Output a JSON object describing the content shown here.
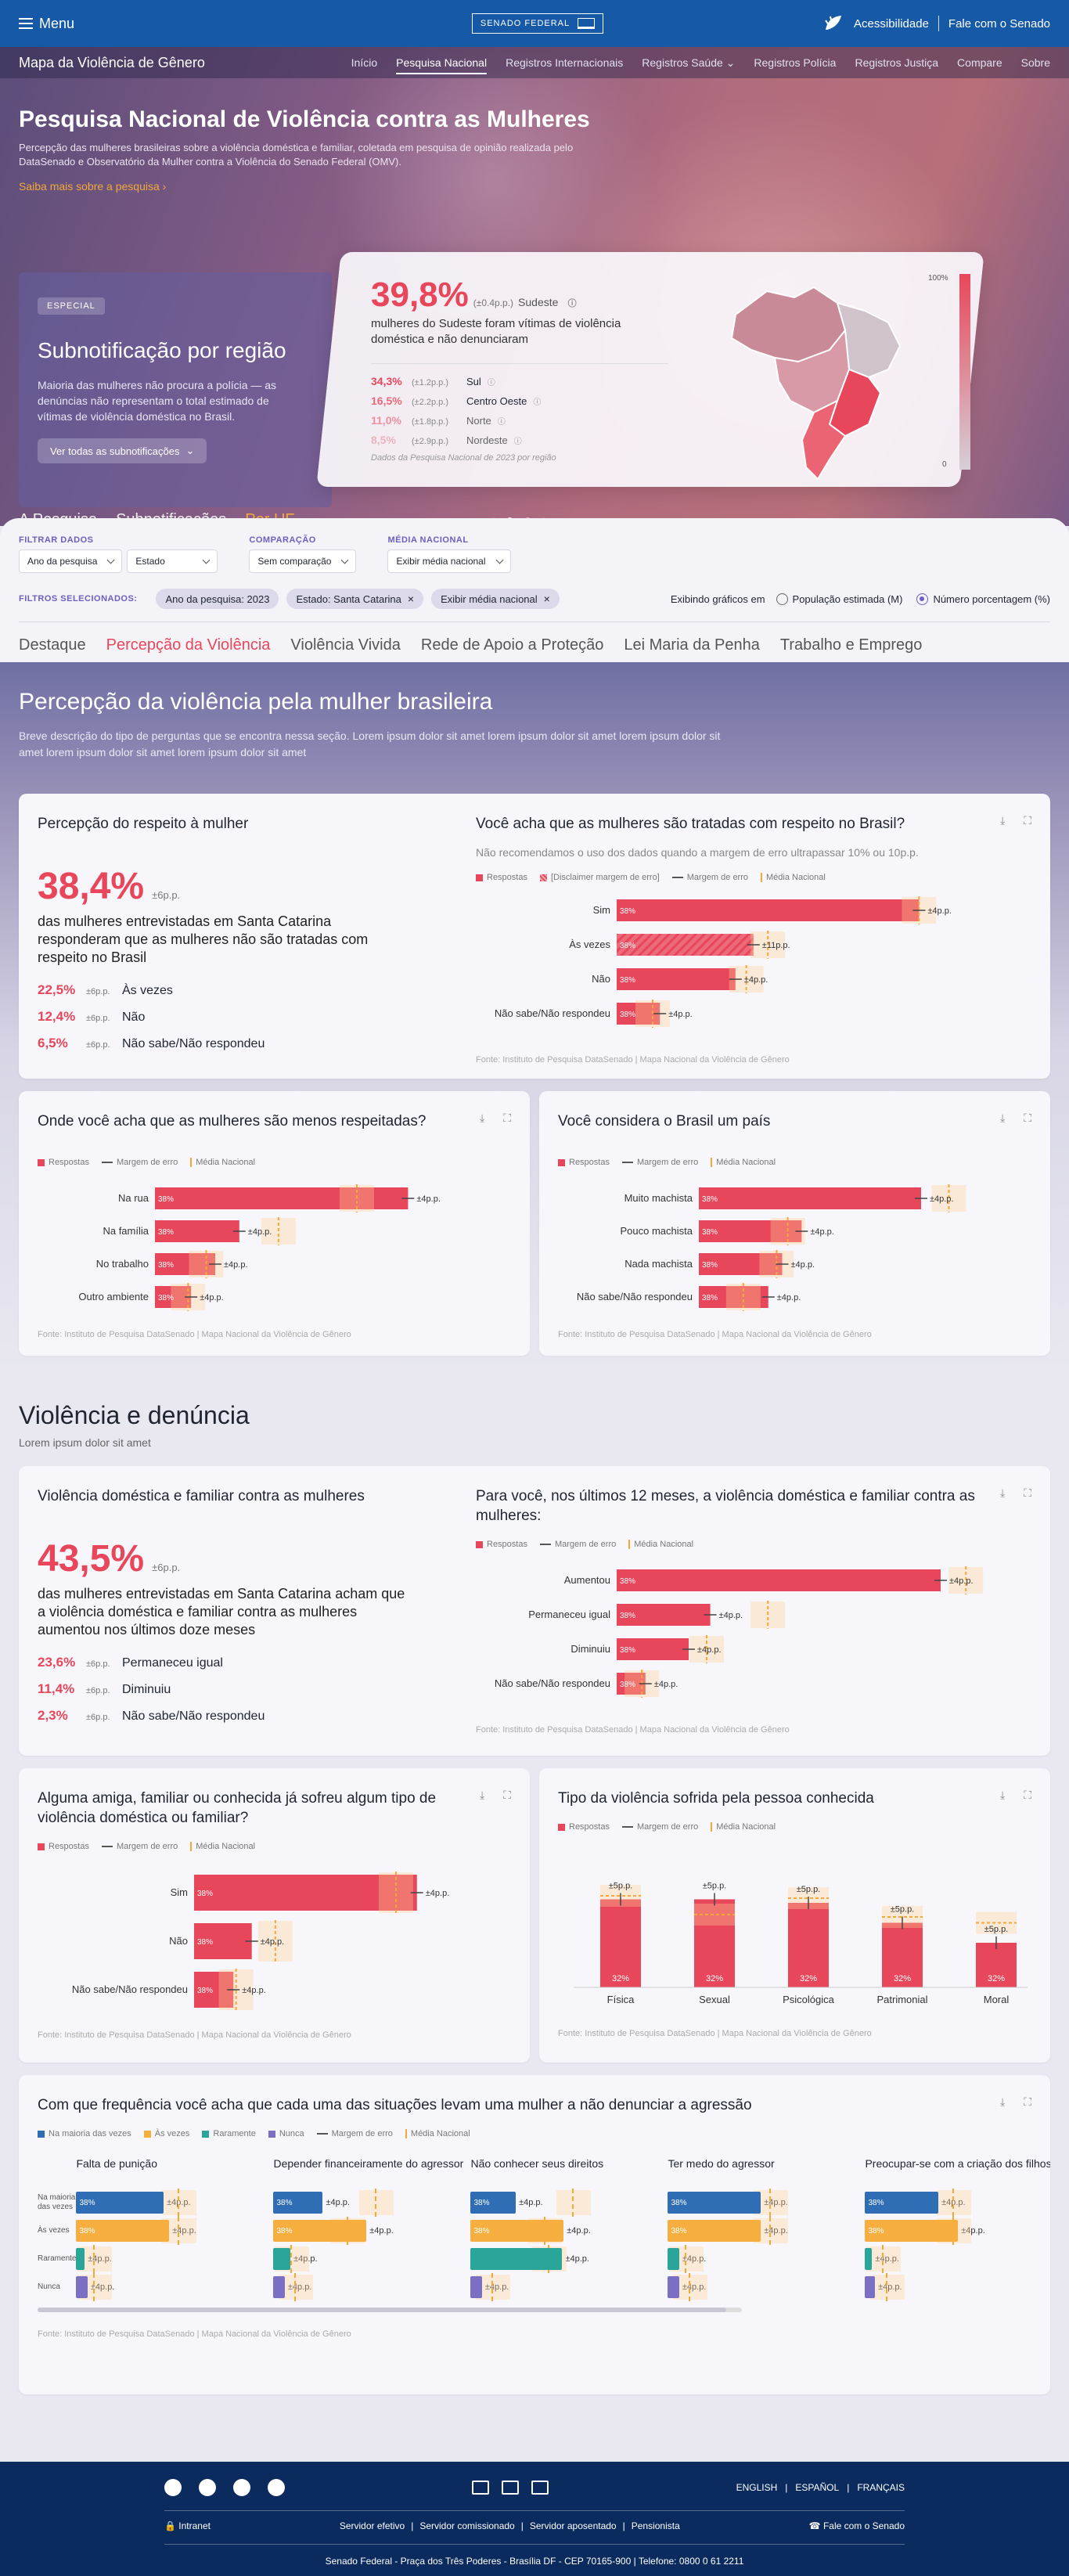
{
  "topbar": {
    "menu": "Menu",
    "logo": "SENADO FEDERAL",
    "accessibility": "Acessibilidade",
    "contact": "Fale com o Senado"
  },
  "subnav": {
    "brand": "Mapa da Violência de Gênero",
    "items": [
      "Início",
      "Pesquisa Nacional",
      "Registros Internacionais",
      "Registros Saúde",
      "Registros Polícia",
      "Registros Justiça",
      "Compare",
      "Sobre"
    ],
    "active": 1
  },
  "hero": {
    "title": "Pesquisa Nacional de Violência contra as Mulheres",
    "description": "Percepção das mulheres brasileiras sobre a violência doméstica e familiar, coletada em pesquisa de opinião realizada pelo DataSenado e Observatório da Mulher contra a Violência do Senado Federal (OMV).",
    "more": "Saiba mais sobre a pesquisa",
    "card": {
      "tag": "ESPECIAL",
      "title": "Subnotificação por região",
      "text": "Maioria das mulheres não procura a polícia — as denúncias não representam o total estimado de vítimas de violência doméstica no Brasil.",
      "button": "Ver todas as subnotificações"
    },
    "stat": {
      "value": "39,8%",
      "margin": "(±0.4p.p.)",
      "region": "Sudeste",
      "desc": "mulheres do Sudeste foram vítimas de violência doméstica e não denunciaram",
      "others": [
        {
          "value": "34,3%",
          "margin": "(±1.2p.p.)",
          "region": "Sul"
        },
        {
          "value": "16,5%",
          "margin": "(±2.2p.p.)",
          "region": "Centro Oeste"
        },
        {
          "value": "11,0%",
          "margin": "(±1.8p.p.)",
          "region": "Norte"
        },
        {
          "value": "8,5%",
          "margin": "(±2.9p.p.)",
          "region": "Nordeste"
        }
      ],
      "source": "Dados da Pesquisa Nacional de 2023 por região",
      "scale_max": "100%",
      "scale_min": "0"
    },
    "tabs": [
      "A Pesquisa",
      "Subnotificações",
      "Por UF"
    ],
    "active_tab": 2
  },
  "filters": {
    "groups": [
      {
        "label": "FILTRAR DADOS",
        "selects": [
          "Ano da pesquisa",
          "Estado"
        ]
      },
      {
        "label": "COMPARAÇÃO",
        "selects": [
          "Sem comparação"
        ]
      },
      {
        "label": "MÉDIA NACIONAL",
        "selects": [
          "Exibir média nacional"
        ]
      }
    ],
    "selected_label": "FILTROS SELECIONADOS:",
    "chips": [
      "Ano da pesquisa: 2023",
      "Estado: Santa Catarina",
      "Exibir média nacional"
    ],
    "showing_label": "Exibindo gráficos em",
    "options": [
      "População estimada (M)",
      "Número porcentagem (%)"
    ],
    "option_selected": 1,
    "section_tabs": [
      "Destaque",
      "Percepção da Violência",
      "Violência Vivida",
      "Rede de Apoio a Proteção",
      "Lei Maria da Penha",
      "Trabalho e Emprego"
    ],
    "section_active": 1
  },
  "section1": {
    "title": "Percepção da violência pela mulher brasileira",
    "desc": "Breve descrição do tipo de perguntas que se encontra nessa seção. Lorem ipsum dolor sit amet lorem ipsum dolor sit amet lorem ipsum dolor sit amet lorem ipsum dolor sit amet lorem ipsum dolor sit amet",
    "respect": {
      "title": "Percepção do respeito à mulher",
      "value": "38,4%",
      "margin": "±6p.p.",
      "text": "das mulheres entrevistadas em Santa Catarina responderam que as mulheres não são tratadas com respeito no Brasil",
      "items": [
        {
          "value": "22,5%",
          "margin": "±6p.p.",
          "label": "Às vezes"
        },
        {
          "value": "12,4%",
          "margin": "±6p.p.",
          "label": "Não"
        },
        {
          "value": "6,5%",
          "margin": "±6p.p.",
          "label": "Não sabe/Não respondeu"
        }
      ]
    },
    "q1": {
      "title": "Você acha que as mulheres são tratadas com respeito no Brasil?",
      "subtitle": "Não recomendamos o uso dos dados quando a margem de erro ultrapassar 10% ou 10p.p.",
      "legend": [
        "Respostas",
        "[Disclaimer margem de erro]",
        "Margem de erro",
        "Média Nacional"
      ],
      "source": "Fonte: Instituto de Pesquisa DataSenado | Mapa Nacional da Violência de Gênero"
    },
    "q2": {
      "title": "Onde você acha que as mulheres são menos respeitadas?",
      "legend": [
        "Respostas",
        "Margem de erro",
        "Média Nacional"
      ],
      "source": "Fonte: Instituto de Pesquisa DataSenado | Mapa Nacional da Violência de Gênero"
    },
    "q3": {
      "title": "Você considera o Brasil um país",
      "legend": [
        "Respostas",
        "Margem de erro",
        "Média Nacional"
      ],
      "source": "Fonte: Instituto de Pesquisa DataSenado | Mapa Nacional da Violência de Gênero"
    }
  },
  "section2": {
    "title": "Violência e denúncia",
    "desc": "Lorem ipsum dolor sit amet",
    "dom": {
      "title": "Violência doméstica e familiar contra as mulheres",
      "value": "43,5%",
      "margin": "±6p.p.",
      "text": "das mulheres entrevistadas em Santa Catarina acham que a violência doméstica e familiar contra as mulheres aumentou nos últimos doze meses",
      "items": [
        {
          "value": "23,6%",
          "margin": "±6p.p.",
          "label": "Permaneceu igual"
        },
        {
          "value": "11,4%",
          "margin": "±6p.p.",
          "label": "Diminuiu"
        },
        {
          "value": "2,3%",
          "margin": "±6p.p.",
          "label": "Não sabe/Não respondeu"
        }
      ]
    },
    "q4": {
      "title": "Para você, nos últimos 12 meses, a violência doméstica e familiar contra as mulheres:",
      "legend": [
        "Respostas",
        "Margem de erro",
        "Média Nacional"
      ],
      "source": "Fonte: Instituto de Pesquisa DataSenado | Mapa Nacional da Violência de Gênero"
    },
    "q5": {
      "title": "Alguma amiga, familiar ou conhecida já sofreu algum tipo de violência doméstica ou familiar?",
      "legend": [
        "Respostas",
        "Margem de erro",
        "Média Nacional"
      ],
      "source": "Fonte: Instituto de Pesquisa DataSenado | Mapa Nacional da Violência de Gênero"
    },
    "q6": {
      "title": "Tipo da violência sofrida pela pessoa conhecida",
      "legend": [
        "Respostas",
        "Margem de erro",
        "Média Nacional"
      ],
      "source": "Fonte: Instituto de Pesquisa DataSenado | Mapa Nacional da Violência de Gênero"
    },
    "q7": {
      "title": "Com que frequência você acha que cada uma das situações levam uma mulher a não denunciar a agressão",
      "legend": [
        "Na maioria das vezes",
        "Às vezes",
        "Raramente",
        "Nunca",
        "Margem de erro",
        "Média Nacional"
      ],
      "rows": [
        "Na maioria das vezes",
        "Às vezes",
        "Raramente",
        "Nunca"
      ],
      "columns": [
        "Falta de punição",
        "Depender financeiramente do agressor",
        "Não conhecer seus direitos",
        "Ter medo do agressor",
        "Preocupar-se com a criação dos filhos"
      ],
      "source": "Fonte: Instituto de Pesquisa DataSenado | Mapa Nacional da Violência de Gênero"
    }
  },
  "colors": {
    "accent": "#e8465a",
    "primary": "#1559a7",
    "purple": "#6b5fc1",
    "orange": "#f3a83a",
    "footer": "#0b2a5e",
    "q7": [
      "#2f6db5",
      "#f6ae3f",
      "#2aa59a",
      "#7a6fc2"
    ]
  },
  "chart_data": [
    {
      "type": "bar",
      "title": "Você acha que as mulheres são tratadas com respeito no Brasil?",
      "categories": [
        "Sim",
        "Às vezes",
        "Não",
        "Não sabe/Não respondeu"
      ],
      "values": [
        38,
        38,
        38,
        38
      ],
      "bar_label": "38%",
      "margins": [
        "±4p.p.",
        "±11p.p.",
        "±4p.p.",
        "±4p.p."
      ],
      "widths": [
        0.84,
        0.38,
        0.33,
        0.12
      ],
      "nat": [
        0.84,
        0.42,
        0.36,
        0.1
      ],
      "warn": [
        false,
        true,
        false,
        false
      ]
    },
    {
      "type": "bar",
      "title": "Onde você acha que as mulheres são menos respeitadas?",
      "categories": [
        "Na rua",
        "Na família",
        "No trabalho",
        "Outro ambiente"
      ],
      "values": [
        38,
        38,
        38,
        38
      ],
      "bar_label": "38%",
      "margins": [
        "±4p.p.",
        "±4p.p.",
        "±4p.p.",
        "±4p.p."
      ],
      "widths": [
        0.84,
        0.28,
        0.2,
        0.12
      ],
      "nat": [
        0.67,
        0.41,
        0.17,
        0.11
      ]
    },
    {
      "type": "bar",
      "title": "Você considera o Brasil um país",
      "categories": [
        "Muito machista",
        "Pouco machista",
        "Nada machista",
        "Não sabe/Não respondeu"
      ],
      "values": [
        38,
        38,
        38,
        38
      ],
      "bar_label": "38%",
      "margins": [
        "±4p.p.",
        "±4p.p.",
        "±4p.p.",
        "±4p.p."
      ],
      "widths": [
        0.8,
        0.37,
        0.3,
        0.25
      ],
      "nat": [
        0.9,
        0.32,
        0.28,
        0.16
      ]
    },
    {
      "type": "bar",
      "title": "Para você, nos últimos 12 meses, a violência doméstica e familiar contra as mulheres:",
      "categories": [
        "Aumentou",
        "Permaneceu igual",
        "Diminuiu",
        "Não sabe/Não respondeu"
      ],
      "values": [
        38,
        38,
        38,
        38
      ],
      "bar_label": "38%",
      "margins": [
        "±4p.p.",
        "±4p.p.",
        "±4p.p.",
        "±4p.p."
      ],
      "widths": [
        0.9,
        0.26,
        0.2,
        0.08
      ],
      "nat": [
        0.97,
        0.42,
        0.25,
        0.07
      ]
    },
    {
      "type": "bar",
      "title": "Alguma amiga, familiar ou conhecida já sofreu algum tipo de violência doméstica ou familiar?",
      "categories": [
        "Sim",
        "Não",
        "Não sabe/Não respondeu"
      ],
      "values": [
        38,
        38,
        38
      ],
      "bar_label": "38%",
      "margins": [
        "±4p.p.",
        "±4p.p.",
        "±4p.p."
      ],
      "widths": [
        0.85,
        0.22,
        0.15
      ],
      "nat": [
        0.77,
        0.31,
        0.16
      ]
    },
    {
      "type": "bar",
      "title": "Tipo da violência sofrida pela pessoa conhecida",
      "categories": [
        "Física",
        "Sexual",
        "Psicológica",
        "Patrimonial",
        "Moral"
      ],
      "values": [
        32,
        32,
        32,
        32,
        32
      ],
      "bar_label": "32%",
      "margins": [
        "±5p.p.",
        "±5p.p.",
        "±5p.p.",
        "±5p.p.",
        "±5p.p."
      ],
      "heights": [
        0.75,
        0.75,
        0.72,
        0.55,
        0.38
      ],
      "nat": [
        0.78,
        0.62,
        0.76,
        0.6,
        0.55
      ]
    }
  ]
}
